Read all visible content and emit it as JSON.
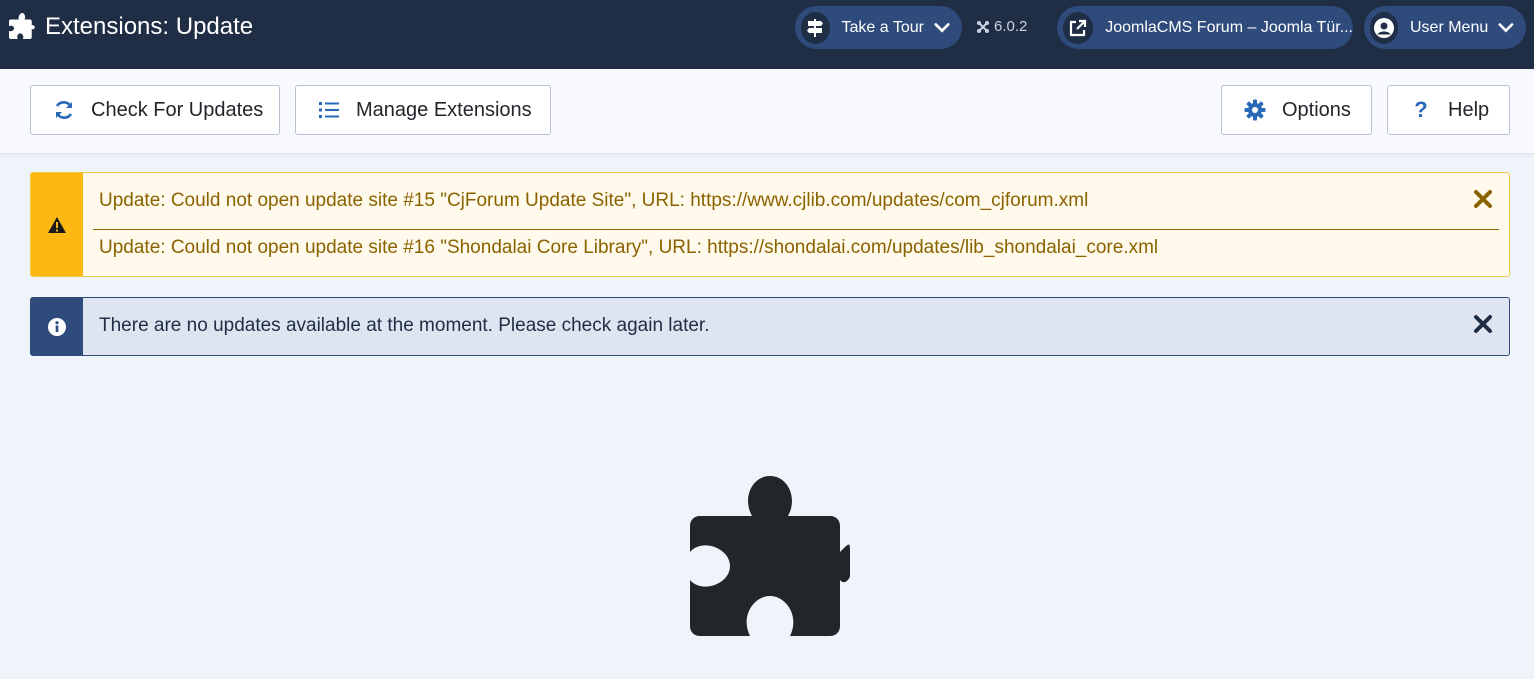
{
  "header": {
    "title": "Extensions: Update",
    "tour_label": "Take a Tour",
    "version": "6.0.2",
    "site_link_label": "JoomlaCMS Forum – Joomla Tür...",
    "user_menu_label": "User Menu"
  },
  "toolbar": {
    "check_label": "Check For Updates",
    "manage_label": "Manage Extensions",
    "options_label": "Options",
    "help_label": "Help"
  },
  "alerts": {
    "warning": {
      "messages": [
        "Update: Could not open update site #15 \"CjForum Update Site\", URL: https://www.cjlib.com/updates/com_cjforum.xml",
        "Update: Could not open update site #16 \"Shondalai Core Library\", URL: https://shondalai.com/updates/lib_shondalai_core.xml"
      ]
    },
    "info": {
      "message": "There are no updates available at the moment. Please check again later."
    }
  },
  "empty_state": {
    "icon": "puzzle-piece-icon",
    "heading": ""
  },
  "colors": {
    "header_bg": "#1f2d45",
    "pill_bg": "#2e4b7c",
    "page_bg": "#eff4fb",
    "warning_accent": "#fdb813",
    "warning_text": "#8a6300",
    "info_accent": "#2e4b7c"
  }
}
